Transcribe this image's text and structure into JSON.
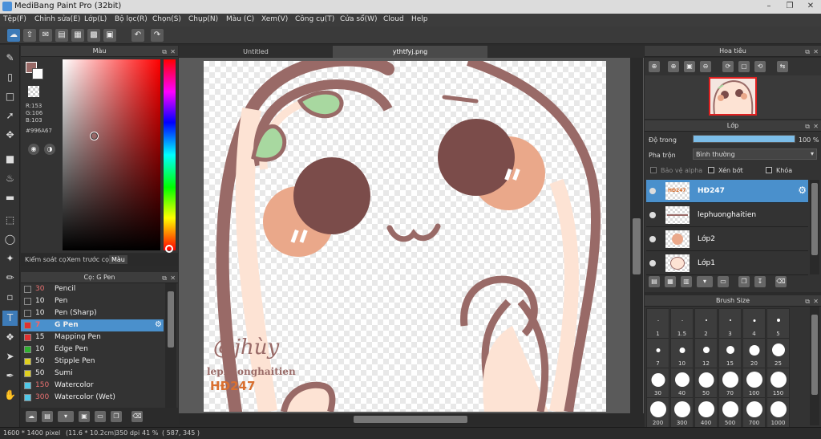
{
  "window": {
    "title": "MediBang Paint Pro (32bit)"
  },
  "menu": [
    "Tệp(F)",
    "Chỉnh sửa(E)",
    "Lớp(L)",
    "Bộ lọc(R)",
    "Chọn(S)",
    "Chụp(N)",
    "Màu (C)",
    "Xem(V)",
    "Công cụ(T)",
    "Cửa sổ(W)",
    "Cloud",
    "Help"
  ],
  "color_panel": {
    "title": "Màu",
    "r": "R:153",
    "g": "G:106",
    "b": "B:103",
    "hex": "#996A67",
    "foreground": "#996a67"
  },
  "left_tabs": [
    "Kiểm soát cọ",
    "Xem trước cọ",
    "Màu"
  ],
  "brush_panel": {
    "title": "Cọ: G Pen",
    "brushes": [
      {
        "size": "30",
        "name": "Pencil",
        "color": "#333333"
      },
      {
        "size": "10",
        "name": "Pen",
        "color": "#333333"
      },
      {
        "size": "10",
        "name": "Pen (Sharp)",
        "color": "#333333"
      },
      {
        "size": "7",
        "name": "G Pen",
        "color": "#e03030"
      },
      {
        "size": "15",
        "name": "Mapping Pen",
        "color": "#e03030"
      },
      {
        "size": "10",
        "name": "Edge Pen",
        "color": "#30b030"
      },
      {
        "size": "50",
        "name": "Stipple Pen",
        "color": "#e0d020"
      },
      {
        "size": "50",
        "name": "Sumi",
        "color": "#e0d020"
      },
      {
        "size": "150",
        "name": "Watercolor",
        "color": "#50c8e8"
      },
      {
        "size": "300",
        "name": "Watercolor (Wet)",
        "color": "#50c8e8"
      }
    ]
  },
  "doc_tabs": [
    "Untitled",
    "ythtfyj.png"
  ],
  "canvas": {
    "signature": "@jhùy",
    "watermark_name": "lephuonghaitien",
    "watermark_code": "HĐ247"
  },
  "navigator": {
    "title": "Hoa tiêu"
  },
  "layer_panel": {
    "title": "Lớp",
    "opacity_label": "Độ trong",
    "opacity_value": "100 %",
    "opacity": 1.0,
    "blend_label": "Pha trộn",
    "blend_value": "Bình thường",
    "protect_alpha": "Bảo vệ alpha",
    "clipping": "Xén bớt",
    "lock": "Khóa",
    "layers": [
      {
        "name": "HĐ247",
        "selected": true
      },
      {
        "name": "lephuonghaitien",
        "selected": false
      },
      {
        "name": "Lớp2",
        "selected": false
      },
      {
        "name": "Lớp1",
        "selected": false
      }
    ]
  },
  "brush_size": {
    "title": "Brush Size",
    "sizes": [
      "1",
      "1.5",
      "2",
      "3",
      "4",
      "5",
      "7",
      "10",
      "12",
      "15",
      "20",
      "25",
      "30",
      "40",
      "50",
      "70",
      "100",
      "150",
      "200",
      "300",
      "400",
      "500",
      "700",
      "1000"
    ]
  },
  "status": {
    "pixels": "1600 * 1400 pixel",
    "cm": "(11.6 * 10.2cm)",
    "dpi": "350 dpi",
    "zoom": "41 %",
    "coords": "( 587, 345 )"
  }
}
